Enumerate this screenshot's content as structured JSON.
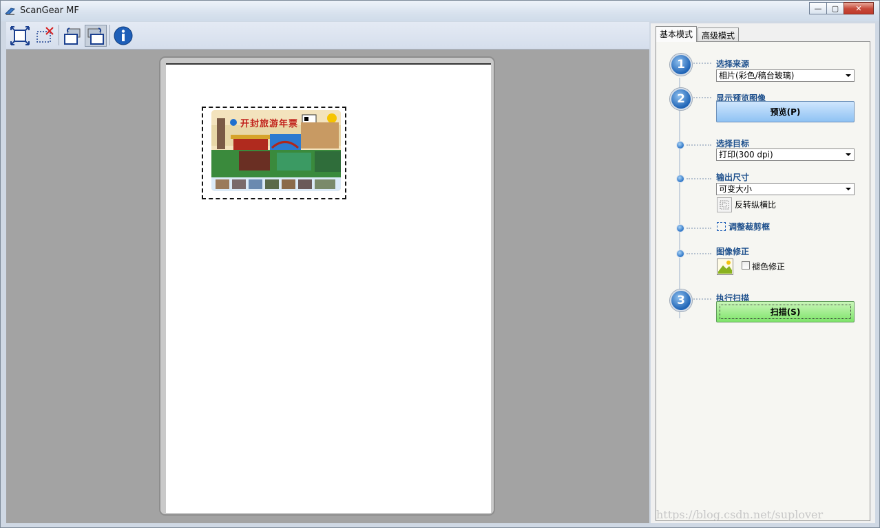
{
  "window": {
    "title": "ScanGear MF",
    "controls": {
      "minimize": "—",
      "maximize": "▢",
      "close": "✕"
    }
  },
  "toolbar": {
    "buttons": [
      {
        "name": "auto-crop",
        "icon": "auto-crop-icon"
      },
      {
        "name": "remove-crop-frame",
        "icon": "remove-crop-frame-icon"
      },
      {
        "name": "rotate-left",
        "icon": "rotate-left-icon"
      },
      {
        "name": "rotate-right",
        "icon": "rotate-right-icon",
        "pressed": true
      },
      {
        "name": "info",
        "icon": "info-icon"
      }
    ]
  },
  "tabs": [
    "基本模式",
    "高级模式"
  ],
  "active_tab": 0,
  "steps": {
    "source": {
      "number": "1",
      "label": "选择来源",
      "value": "相片(彩色/稿台玻璃)"
    },
    "preview": {
      "number": "2",
      "label": "显示预览图像",
      "button": "预览(P)"
    },
    "destination": {
      "label": "选择目标",
      "value": "打印(300 dpi)"
    },
    "output_size": {
      "label": "输出尺寸",
      "value": "可变大小",
      "swap_label": "反转纵横比"
    },
    "crop": {
      "label": "调整裁剪框"
    },
    "correction": {
      "label": "图像修正",
      "fade_label": "褪色修正",
      "fade_checked": false
    },
    "scan": {
      "number": "3",
      "label": "执行扫描",
      "button": "扫描(S)"
    }
  },
  "preview_image": {
    "caption": "开封旅游年票"
  },
  "watermark": "https://blog.csdn.net/suplover",
  "colors": {
    "preview_button": "#8fc2f3",
    "scan_button": "#7ee46a",
    "step_label": "#1d4f8c",
    "step_circle": "#1f64b6"
  }
}
